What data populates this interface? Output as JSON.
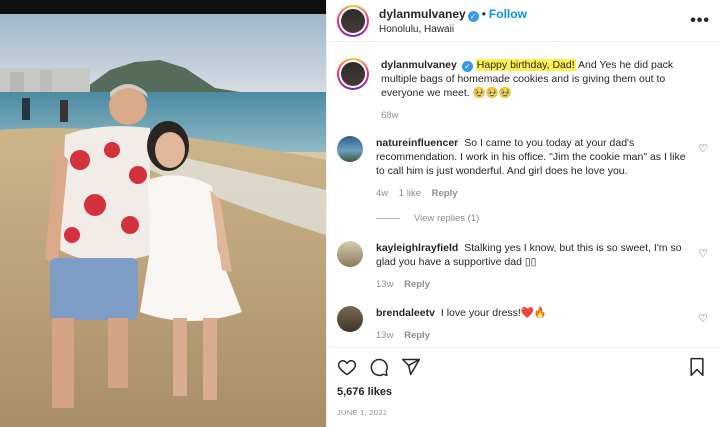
{
  "post": {
    "username": "dylanmulvaney",
    "follow_label": "Follow",
    "location": "Honolulu, Hawaii",
    "more_label": "•••"
  },
  "caption": {
    "username": "dylanmulvaney",
    "highlight": "Happy birthday, Dad!",
    "text": " And Yes he did pack multiple bags of homemade cookies and is giving them out to everyone we meet. 🥹🥹🥹",
    "time": "68w"
  },
  "comments": [
    {
      "username": "natureinfluencer",
      "text": "So I came to you today at your dad's recommendation. I work in his office. \"Jim the cookie man\" as I like to call him is just wonderful. And girl does he love you.",
      "time": "4w",
      "likes": "1 like",
      "reply_label": "Reply",
      "view_replies": "View replies (1)"
    },
    {
      "username": "kayleighlrayfield",
      "text": "Stalking yes I know, but this is so sweet, I'm so glad you have a supportive dad ▯▯",
      "time": "13w",
      "reply_label": "Reply"
    },
    {
      "username": "brendaleetv",
      "text": "I love your dress!❤️🔥",
      "time": "13w",
      "reply_label": "Reply"
    }
  ],
  "footer": {
    "likes": "5,676 likes",
    "date": "JUNE 1, 2021"
  },
  "icons": {
    "like": "heart-icon",
    "comment": "comment-icon",
    "share": "share-icon",
    "save": "bookmark-icon",
    "verified": "verified-badge-icon"
  }
}
